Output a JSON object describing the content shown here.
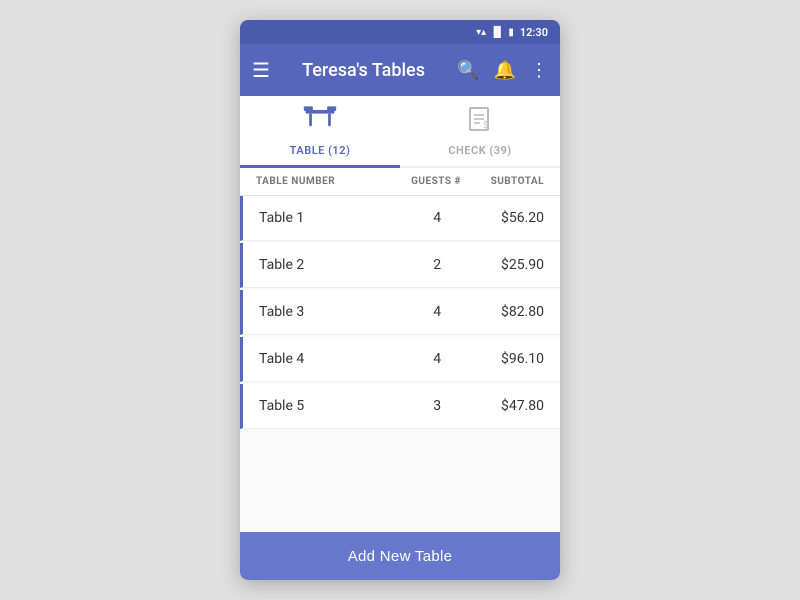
{
  "status": {
    "time": "12:30",
    "wifi": "▼▲",
    "signal": "▐",
    "battery": "🔋"
  },
  "nav": {
    "menu_icon": "☰",
    "title": "Teresa's Tables",
    "search_icon": "🔍",
    "notification_icon": "🔔",
    "more_icon": "⋮"
  },
  "tabs": [
    {
      "id": "table",
      "label": "TABLE (12)",
      "active": true
    },
    {
      "id": "check",
      "label": "CHECK (39)",
      "active": false
    }
  ],
  "list_headers": {
    "name": "TABLE NUMBER",
    "guests": "GUESTS #",
    "subtotal": "SUBTOTAL"
  },
  "tables": [
    {
      "name": "Table 1",
      "guests": "4",
      "subtotal": "$56.20"
    },
    {
      "name": "Table 2",
      "guests": "2",
      "subtotal": "$25.90"
    },
    {
      "name": "Table 3",
      "guests": "4",
      "subtotal": "$82.80"
    },
    {
      "name": "Table 4",
      "guests": "4",
      "subtotal": "$96.10"
    },
    {
      "name": "Table 5",
      "guests": "3",
      "subtotal": "$47.80"
    }
  ],
  "add_button": "Add New Table",
  "colors": {
    "primary": "#5566bb",
    "accent": "#6677cc"
  }
}
